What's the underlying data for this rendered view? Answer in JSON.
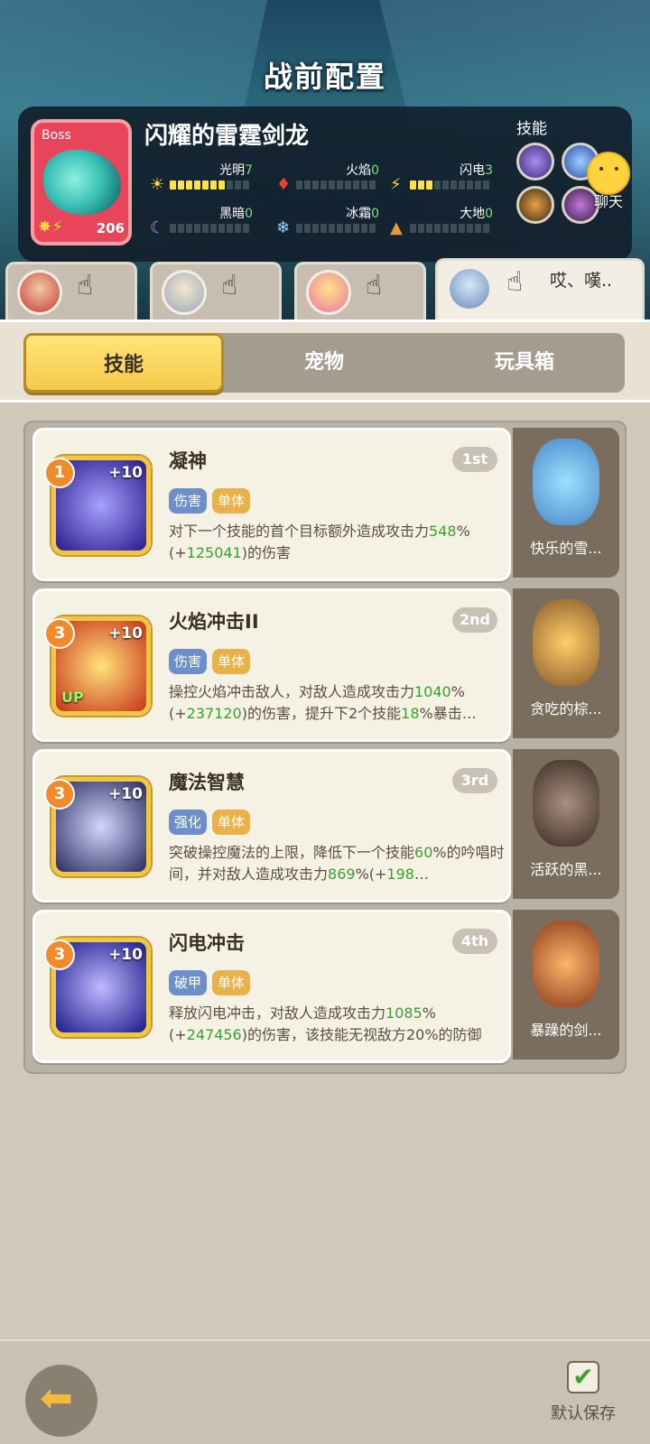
{
  "header": {
    "title": "战前配置"
  },
  "boss": {
    "tag": "Boss",
    "name": "闪耀的雷霆剑龙",
    "level": "206",
    "stats": [
      {
        "label": "光明",
        "value": "7",
        "icon": "☀",
        "fill": 7
      },
      {
        "label": "火焰",
        "value": "0",
        "icon": "🔥",
        "fill": 0
      },
      {
        "label": "闪电",
        "value": "3",
        "icon": "⚡",
        "fill": 3
      },
      {
        "label": "黑暗",
        "value": "0",
        "icon": "☾",
        "fill": 0
      },
      {
        "label": "冰霜",
        "value": "0",
        "icon": "❄",
        "fill": 0
      },
      {
        "label": "大地",
        "value": "0",
        "icon": "▲",
        "fill": 0
      }
    ],
    "skills_label": "技能"
  },
  "chat": {
    "label": "聊天"
  },
  "team_tabs": [
    {
      "name": "hero-1"
    },
    {
      "name": "hero-2"
    },
    {
      "name": "hero-3"
    },
    {
      "name": "hero-4",
      "message": "哎、嘆.."
    }
  ],
  "tabs": [
    "技能",
    "宠物",
    "玩具箱"
  ],
  "skills": [
    {
      "name": "凝神",
      "level": "1",
      "plus": "+10",
      "rank": "1st",
      "tags": [
        "伤害",
        "单体"
      ],
      "desc_parts": [
        [
          "对下一个技能的首个目标额外造成攻击力",
          ""
        ],
        [
          "548",
          "g"
        ],
        [
          "%(+",
          ""
        ],
        [
          "125041",
          "g"
        ],
        [
          ")的伤害",
          ""
        ]
      ],
      "pet": "快乐的雪..."
    },
    {
      "name": "火焰冲击II",
      "level": "3",
      "plus": "+10",
      "rank": "2nd",
      "up": "UP",
      "tags": [
        "伤害",
        "单体"
      ],
      "desc_parts": [
        [
          "操控火焰冲击敌人，对敌人造成攻击力",
          ""
        ],
        [
          "1040",
          "g"
        ],
        [
          "%(+",
          ""
        ],
        [
          "237120",
          "g"
        ],
        [
          ")的伤害，提升下2个技能",
          ""
        ],
        [
          "18",
          "g"
        ],
        [
          "%暴击…",
          ""
        ]
      ],
      "pet": "贪吃的棕..."
    },
    {
      "name": "魔法智慧",
      "level": "3",
      "plus": "+10",
      "rank": "3rd",
      "tags": [
        "强化",
        "单体"
      ],
      "desc_parts": [
        [
          "突破操控魔法的上限，降低下一个技能",
          ""
        ],
        [
          "60",
          "g"
        ],
        [
          "%的吟唱时间，并对敌人造成攻击力",
          ""
        ],
        [
          "869",
          "g"
        ],
        [
          "%(+",
          ""
        ],
        [
          "198",
          "g"
        ],
        [
          "…",
          ""
        ]
      ],
      "pet": "活跃的黑..."
    },
    {
      "name": "闪电冲击",
      "level": "3",
      "plus": "+10",
      "rank": "4th",
      "tags": [
        "破甲",
        "单体"
      ],
      "desc_parts": [
        [
          "释放闪电冲击，对敌人造成攻击力",
          ""
        ],
        [
          "1085",
          "g"
        ],
        [
          "%(+",
          ""
        ],
        [
          "247456",
          "g"
        ],
        [
          ")的伤害，该技能无视敌方20%的防御",
          ""
        ]
      ],
      "pet": "暴躁的剑..."
    }
  ],
  "footer": {
    "save_label": "默认保存"
  }
}
